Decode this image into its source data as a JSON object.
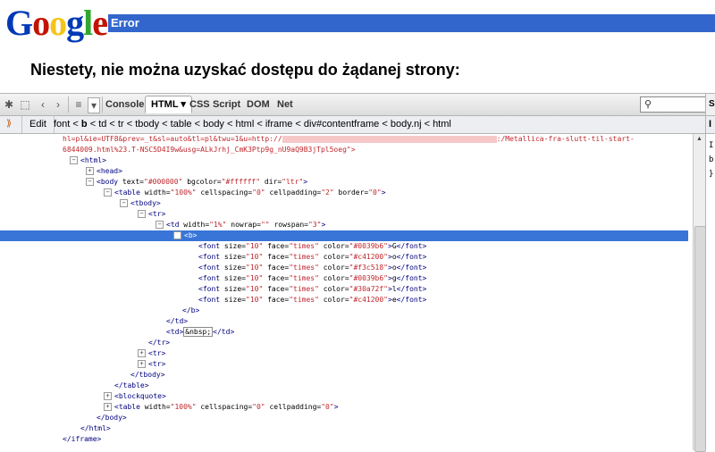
{
  "logo": {
    "letters": [
      "G",
      "o",
      "o",
      "g",
      "l",
      "e"
    ],
    "colors": [
      "#0039b6",
      "#c41200",
      "#f3c518",
      "#0039b6",
      "#30a72f",
      "#c41200"
    ]
  },
  "error_bar": {
    "label": "Error",
    "color": "#3366cc"
  },
  "message": "Niestety, nie można uzyskać dostępu do żądanej strony:",
  "firebug": {
    "toolbar": {
      "tabs": [
        {
          "label": "Console",
          "active": false
        },
        {
          "label": "HTML",
          "active": true
        },
        {
          "label": "CSS",
          "active": false
        },
        {
          "label": "Script",
          "active": false
        },
        {
          "label": "DOM",
          "active": false
        },
        {
          "label": "Net",
          "active": false
        }
      ],
      "search_placeholder": ""
    },
    "breadcrumb": {
      "edit_label": "Edit",
      "path": [
        "font",
        "b",
        "td",
        "tr",
        "tbody",
        "table",
        "body",
        "html",
        "iframe",
        "div#contentframe",
        "body.nj",
        "html"
      ],
      "current_index": 1
    },
    "side_panel_label": "S",
    "side_panel_lines": [
      "I",
      "b",
      "}"
    ],
    "html_lines": [
      {
        "html": "hl=pl&amp;ie=UTF8&amp;prev=_t&amp;sl=auto&amp;tl=pl&amp;twu=1&amp;u=http://<span class=\"redact\" style=\"width:240px\"></span>:/Metallica-fra-slutt-til-start-",
        "cls": "val"
      },
      {
        "html": "6844009.html%23.T-NSC5D4I9w&amp;usg=ALkJrhj_CmK3Ptp9g_nU9aQ9B3jTpl5oeg\"&gt;",
        "cls": "val"
      },
      {
        "html": "<span class=\"twisty\">−</span>&lt;html&gt;"
      },
      {
        "html": "<span class=\"twisty\">+</span>&lt;head&gt;"
      },
      {
        "html": "<span class=\"twisty\">−</span>&lt;body <span class=\"attr\">text=</span><span class=\"val\">\"#000000\"</span> <span class=\"attr\">bgcolor=</span><span class=\"val\">\"#ffffff\"</span> <span class=\"attr\">dir=</span><span class=\"val\">\"ltr\"</span>&gt;"
      },
      {
        "html": "<span class=\"twisty\">−</span>&lt;table <span class=\"attr\">width=</span><span class=\"val\">\"100%\"</span> <span class=\"attr\">cellspacing=</span><span class=\"val\">\"0\"</span> <span class=\"attr\">cellpadding=</span><span class=\"val\">\"2\"</span> <span class=\"attr\">border=</span><span class=\"val\">\"0\"</span>&gt;"
      },
      {
        "html": "<span class=\"twisty\">−</span>&lt;tbody&gt;"
      },
      {
        "html": "<span class=\"twisty\">−</span>&lt;tr&gt;"
      },
      {
        "html": "<span class=\"twisty\">−</span>&lt;td <span class=\"attr\">width=</span><span class=\"val\">\"1%\"</span> <span class=\"attr\">nowrap=</span><span class=\"val\">\"\"</span> <span class=\"attr\">rowspan=</span><span class=\"val\">\"3\"</span>&gt;"
      },
      {
        "html": "<span class=\"twisty\">−</span>&lt;b&gt;",
        "selected": true
      },
      {
        "html": "&lt;font <span class=\"attr\">size=</span><span class=\"val\">\"10\"</span> <span class=\"attr\">face=</span><span class=\"val\">\"times\"</span> <span class=\"attr\">color=</span><span class=\"val\">\"#0039b6\"</span>&gt;<span class=\"txt\">G</span>&lt;/font&gt;"
      },
      {
        "html": "&lt;font <span class=\"attr\">size=</span><span class=\"val\">\"10\"</span> <span class=\"attr\">face=</span><span class=\"val\">\"times\"</span> <span class=\"attr\">color=</span><span class=\"val\">\"#c41200\"</span>&gt;<span class=\"txt\">o</span>&lt;/font&gt;"
      },
      {
        "html": "&lt;font <span class=\"attr\">size=</span><span class=\"val\">\"10\"</span> <span class=\"attr\">face=</span><span class=\"val\">\"times\"</span> <span class=\"attr\">color=</span><span class=\"val\">\"#f3c518\"</span>&gt;<span class=\"txt\">o</span>&lt;/font&gt;"
      },
      {
        "html": "&lt;font <span class=\"attr\">size=</span><span class=\"val\">\"10\"</span> <span class=\"attr\">face=</span><span class=\"val\">\"times\"</span> <span class=\"attr\">color=</span><span class=\"val\">\"#0039b6\"</span>&gt;<span class=\"txt\">g</span>&lt;/font&gt;"
      },
      {
        "html": "&lt;font <span class=\"attr\">size=</span><span class=\"val\">\"10\"</span> <span class=\"attr\">face=</span><span class=\"val\">\"times\"</span> <span class=\"attr\">color=</span><span class=\"val\">\"#30a72f\"</span>&gt;<span class=\"txt\">l</span>&lt;/font&gt;"
      },
      {
        "html": "&lt;font <span class=\"attr\">size=</span><span class=\"val\">\"10\"</span> <span class=\"attr\">face=</span><span class=\"val\">\"times\"</span> <span class=\"attr\">color=</span><span class=\"val\">\"#c41200\"</span>&gt;<span class=\"txt\">e</span>&lt;/font&gt;"
      },
      {
        "html": "&lt;/b&gt;"
      },
      {
        "html": "&lt;/td&gt;"
      },
      {
        "html": "&lt;td&gt;<span class=\"nbsp\">&amp;nbsp;</span>&lt;/td&gt;"
      },
      {
        "html": "&lt;/tr&gt;"
      },
      {
        "html": "<span class=\"twisty\">+</span>&lt;tr&gt;"
      },
      {
        "html": "<span class=\"twisty\">+</span>&lt;tr&gt;"
      },
      {
        "html": "&lt;/tbody&gt;"
      },
      {
        "html": "&lt;/table&gt;"
      },
      {
        "html": "<span class=\"twisty\">+</span>&lt;blockquote&gt;"
      },
      {
        "html": "<span class=\"twisty\">+</span>&lt;table <span class=\"attr\">width=</span><span class=\"val\">\"100%\"</span> <span class=\"attr\">cellspacing=</span><span class=\"val\">\"0\"</span> <span class=\"attr\">cellpadding=</span><span class=\"val\">\"0\"</span>&gt;"
      },
      {
        "html": "&lt;/body&gt;"
      },
      {
        "html": "&lt;/html&gt;"
      },
      {
        "html": "&lt;/iframe&gt;"
      }
    ]
  }
}
